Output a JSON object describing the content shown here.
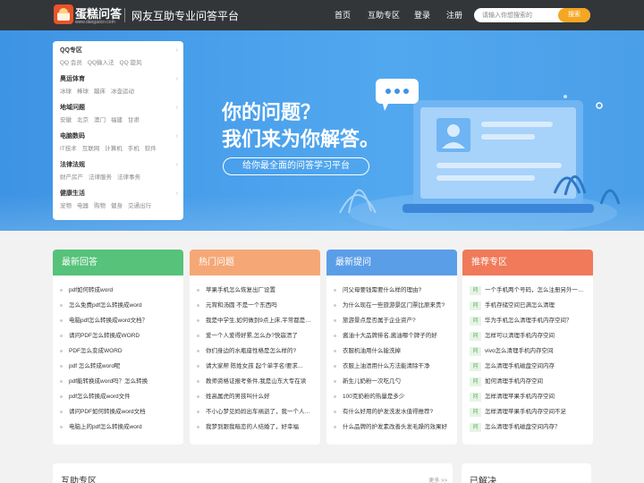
{
  "header": {
    "logo_name": "蛋糕问答",
    "logo_url": "www.dangaocn.com",
    "slogan": "网友互助专业问答平台",
    "nav": [
      "首页",
      "互助专区",
      "登录",
      "注册"
    ],
    "search": {
      "placeholder": "请输入你想搜索的",
      "button": "搜索"
    }
  },
  "categories": [
    {
      "title": "QQ专区",
      "links": [
        "QQ 会员",
        "QQ输入法",
        "QQ 旋风"
      ]
    },
    {
      "title": "奥运体育",
      "links": [
        "冰球",
        "棒球",
        "蹦床",
        "冰壶运动"
      ]
    },
    {
      "title": "地域问题",
      "links": [
        "安徽",
        "北京",
        "澳门",
        "福建",
        "甘肃"
      ]
    },
    {
      "title": "电脑数码",
      "links": [
        "IT技术",
        "互联网",
        "计算机",
        "手机",
        "软件"
      ]
    },
    {
      "title": "法律法规",
      "links": [
        "财产房产",
        "法律服务",
        "法律事务"
      ]
    },
    {
      "title": "健康生活",
      "links": [
        "宠物",
        "电器",
        "购物",
        "健身",
        "交通出行"
      ]
    }
  ],
  "banner": {
    "line1": "你的问题？",
    "line2": "我们来为你解答。",
    "subtitle": "给你最全面的问答学习平台"
  },
  "cards": [
    {
      "title": "最新回答",
      "color": "#56c27a",
      "items": [
        "pdf如何转成word",
        "怎么免费pdf怎么转换成word",
        "电脑pdf怎么转换成word文档？",
        "请问PDF怎么转换成WORD",
        "PDF怎么变成WORD",
        "pdf 怎么转成word呢",
        "pdf能转换成word吗？怎么转换",
        "pdf怎么转换成word文件",
        "请问PDF如何转换成word文档",
        "电脑上的pdf怎么转换成word"
      ]
    },
    {
      "title": "热门问题",
      "color": "#f5a876",
      "items": [
        "苹果手机怎么恢复出厂设置",
        "元宵和汤圆 不是一个东西吗",
        "我是中学生,如何做到9点上床,平常都是十一点钟...",
        "爱一个人爱得好累,怎么办?快崩溃了",
        "你们身边的水瓶座性格是怎么样的?",
        "请大家帮 陈姓女孩 起个单字名!要求...",
        "教师资格证报考条件,我是山东大专在读",
        "姓高属虎的男孩叫什么好",
        "不小心梦见妈妈出车祸逝了，我一个人在哭",
        "我梦到跟我暗恋的人结婚了，好幸福"
      ]
    },
    {
      "title": "最新提问",
      "color": "#5b9ee8",
      "items": [
        "问父母要钱需要什么样的理由?",
        "为什么现在一些旅游景区门票比原来贵?",
        "旅游景点是否属于企业资产?",
        "酱油十大品牌排名,酱油哪个牌子的好",
        "衣服机油用什么能洗掉",
        "衣服上油渍用什么方法能清除干净",
        "新生儿奶粉一次吃几勺",
        "100克奶粉的热量是多少",
        "有什么好用的护发洗发水值得推荐?",
        "什么品牌的护发素改善头发毛躁的效果好"
      ]
    },
    {
      "title": "推荐专区",
      "color": "#f07a5a",
      "tag": "问",
      "items": [
        "一个手机两个号码，怎么注册另外一个微信",
        "手机存储空间已满怎么清理",
        "华为手机怎么清理手机内存空间？",
        "怎样可以清理手机内存空间",
        "vivo怎么清理手机内存空间",
        "怎么清理手机磁盘空间内存",
        "如何清理手机内存空间",
        "怎样清理苹果手机内存空间",
        "怎样清理苹果手机内存空间不足",
        "怎么清理手机磁盘空间内存？"
      ]
    }
  ],
  "bottom": {
    "left_title": "互助专区",
    "more": "更多 >>",
    "right_title": "已解决"
  },
  "colors": {
    "header": "#333639",
    "banner": "#4a9fe8",
    "accent": "#f5a623"
  }
}
